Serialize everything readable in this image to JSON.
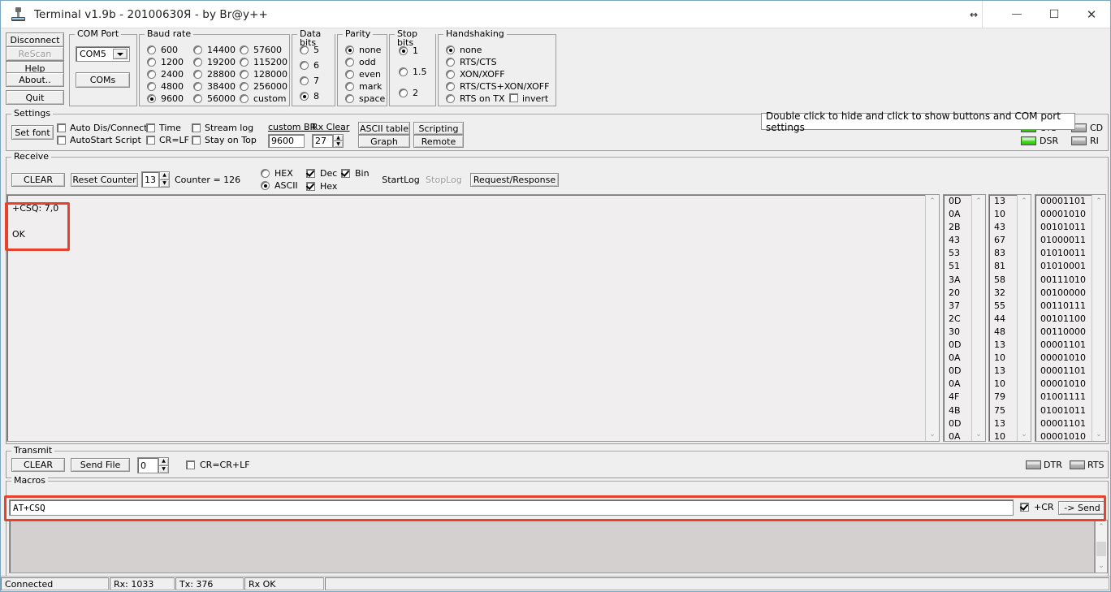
{
  "window": {
    "title": "Terminal v1.9b - 20100630Я - by Br@y++",
    "controls": {
      "resize": "↔",
      "minimize": "—",
      "maximize": "☐",
      "close": "✕"
    }
  },
  "left_buttons": [
    {
      "label": "Disconnect",
      "disabled": false
    },
    {
      "label": "ReScan",
      "disabled": true
    },
    {
      "label": "Help",
      "disabled": false
    },
    {
      "label": "About..",
      "disabled": false
    },
    {
      "label": "Quit",
      "disabled": false
    }
  ],
  "com_port": {
    "legend": "COM Port",
    "selected": "COM5",
    "scan_button": "COMs"
  },
  "baud_rate": {
    "legend": "Baud rate",
    "selected": "9600",
    "col1": [
      "600",
      "1200",
      "2400",
      "4800",
      "9600"
    ],
    "col2": [
      "14400",
      "19200",
      "28800",
      "38400",
      "56000"
    ],
    "col3": [
      "57600",
      "115200",
      "128000",
      "256000",
      "custom"
    ]
  },
  "data_bits": {
    "legend": "Data bits",
    "selected": "8",
    "options": [
      "5",
      "6",
      "7",
      "8"
    ]
  },
  "parity": {
    "legend": "Parity",
    "selected": "none",
    "options": [
      "none",
      "odd",
      "even",
      "mark",
      "space"
    ]
  },
  "stop_bits": {
    "legend": "Stop bits",
    "selected": "1",
    "options": [
      "1",
      "1.5",
      "2"
    ]
  },
  "handshaking": {
    "legend": "Handshaking",
    "selected": "none",
    "options": [
      "none",
      "RTS/CTS",
      "XON/XOFF",
      "RTS/CTS+XON/XOFF",
      "RTS on TX"
    ],
    "invert_label": "invert",
    "invert_checked": false
  },
  "settings": {
    "legend": "Settings",
    "set_font": "Set font",
    "checkboxes": [
      {
        "label": "Auto Dis/Connect",
        "checked": false
      },
      {
        "label": "AutoStart Script",
        "checked": false
      },
      {
        "label": "Time",
        "checked": false
      },
      {
        "label": "CR=LF",
        "checked": false
      },
      {
        "label": "Stream log",
        "checked": false
      },
      {
        "label": "Stay on Top",
        "checked": false
      }
    ],
    "custom_br_label": "custom BR",
    "custom_br_value": "9600",
    "rx_clear_label": "Rx Clear",
    "rx_clear_value": "27",
    "buttons": [
      "ASCII table",
      "Scripting",
      "Graph",
      "Remote"
    ]
  },
  "hint_banner": "Double click to hide and click to show buttons and COM port settings",
  "leds_top": [
    {
      "label": "CTS",
      "on": true
    },
    {
      "label": "CD",
      "on": false
    },
    {
      "label": "DSR",
      "on": true
    },
    {
      "label": "RI",
      "on": false
    }
  ],
  "receive": {
    "legend": "Receive",
    "clear_button": "CLEAR",
    "reset_counter_button": "Reset Counter",
    "counter_spinner_value": "13",
    "counter_text": "Counter = 126",
    "format_selected": "ASCII",
    "format_options": [
      "HEX",
      "ASCII"
    ],
    "checkboxes": [
      {
        "label": "Dec",
        "checked": true
      },
      {
        "label": "Hex",
        "checked": true
      },
      {
        "label": "Bin",
        "checked": true
      }
    ],
    "startlog_button": "StartLog",
    "stoplog_button": "StopLog",
    "stoplog_disabled": true,
    "request_response_button": "Request/Response",
    "text_lines": [
      "+CSQ: 7,0",
      "OK"
    ]
  },
  "data_columns": {
    "hex": [
      "0D",
      "0A",
      "2B",
      "43",
      "53",
      "51",
      "3A",
      "20",
      "37",
      "2C",
      "30",
      "0D",
      "0A",
      "0D",
      "0A",
      "4F",
      "4B",
      "0D",
      "0A"
    ],
    "dec": [
      "13",
      "10",
      "43",
      "67",
      "83",
      "81",
      "58",
      "32",
      "55",
      "44",
      "48",
      "13",
      "10",
      "13",
      "10",
      "79",
      "75",
      "13",
      "10"
    ],
    "bin": [
      "00001101",
      "00001010",
      "00101011",
      "01000011",
      "01010011",
      "01010001",
      "00111010",
      "00100000",
      "00110111",
      "00101100",
      "00110000",
      "00001101",
      "00001010",
      "00001101",
      "00001010",
      "01001111",
      "01001011",
      "00001101",
      "00001010"
    ]
  },
  "transmit": {
    "legend": "Transmit",
    "clear_button": "CLEAR",
    "send_file_button": "Send File",
    "delay_value": "0",
    "crlf_label": "CR=CR+LF",
    "crlf_checked": false,
    "leds": [
      {
        "label": "DTR",
        "on": false
      },
      {
        "label": "RTS",
        "on": false
      }
    ]
  },
  "macros": {
    "legend": "Macros",
    "command_value": "AT+CSQ",
    "cr_label": "+CR",
    "cr_checked": true,
    "send_button": "-> Send"
  },
  "statusbar": {
    "connection": "Connected",
    "rx": "Rx: 1033",
    "tx": "Tx: 376",
    "rx_status": "Rx OK",
    "extra": ""
  },
  "colors": {
    "highlight": "#e8412c",
    "led_on": "#24c200",
    "window_bg": "#efefef"
  }
}
